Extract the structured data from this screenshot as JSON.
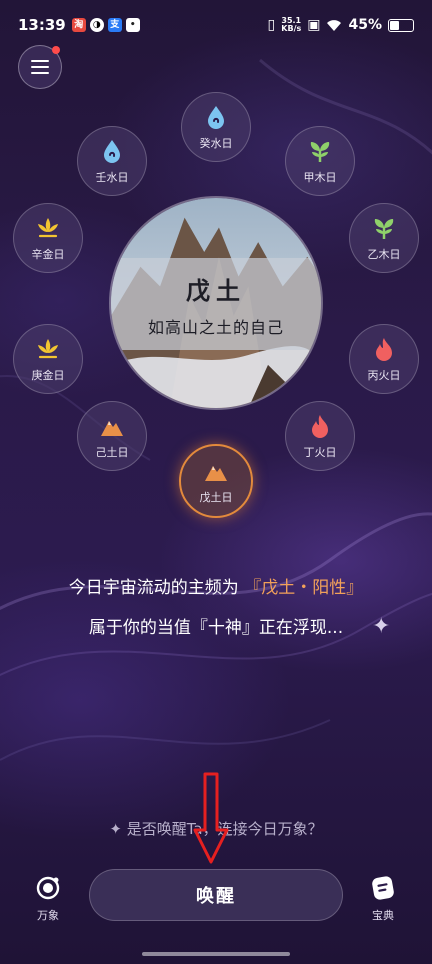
{
  "status_bar": {
    "time": "13:39",
    "net_speed_value": "35.1",
    "net_speed_unit": "KB/s",
    "battery": "45%",
    "battery_level": 0.45
  },
  "wheel": {
    "items": [
      {
        "label": "癸水日",
        "icon": "water-drop-icon",
        "color": "#7cc4f0"
      },
      {
        "label": "甲木日",
        "icon": "sprout-icon",
        "color": "#8fd16a"
      },
      {
        "label": "乙木日",
        "icon": "sprout-icon",
        "color": "#8fd16a"
      },
      {
        "label": "丙火日",
        "icon": "flame-icon",
        "color": "#f06060"
      },
      {
        "label": "丁火日",
        "icon": "flame-icon",
        "color": "#f06060"
      },
      {
        "label": "戊土日",
        "icon": "mountain-icon",
        "color": "#e89048"
      },
      {
        "label": "己土日",
        "icon": "mountain-icon",
        "color": "#e89048"
      },
      {
        "label": "庚金日",
        "icon": "lotus-icon",
        "color": "#f3c531"
      },
      {
        "label": "辛金日",
        "icon": "lotus-icon",
        "color": "#f3c531"
      },
      {
        "label": "壬水日",
        "icon": "water-drop-icon",
        "color": "#7cc4f0"
      }
    ],
    "active": "戊土日"
  },
  "center": {
    "title": "戊土",
    "subtitle": "如高山之土的自己"
  },
  "message": {
    "line1_prefix": "今日宇宙流动的主频为",
    "line1_highlight": "『戊土・阳性』",
    "line2": "属于你的当值『十神』正在浮现..."
  },
  "prompt": "✦ 是否唤醒Ta，连接今日万象？",
  "wake_button": "唤醒",
  "bottom_nav": {
    "left_label": "万象",
    "right_label": "宝典"
  }
}
